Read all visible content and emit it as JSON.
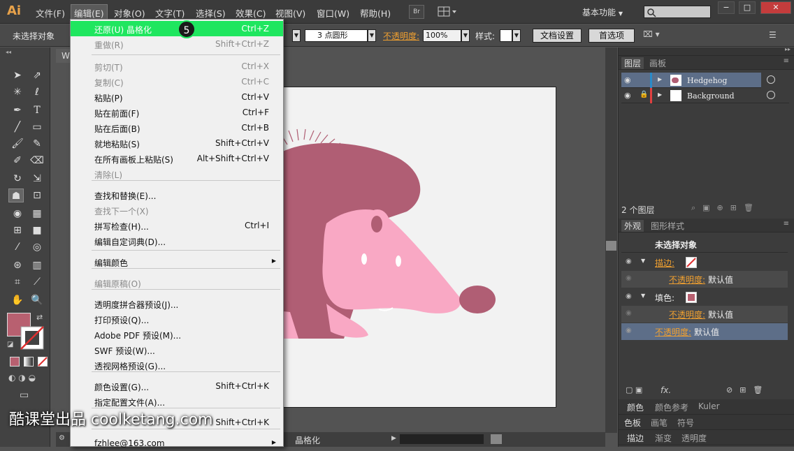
{
  "menubar": {
    "logo": "Ai",
    "items": [
      "文件(F)",
      "编辑(E)",
      "对象(O)",
      "文字(T)",
      "选择(S)",
      "效果(C)",
      "视图(V)",
      "窗口(W)",
      "帮助(H)"
    ],
    "br": "Br",
    "workspace": "基本功能",
    "win_min": "−",
    "win_max": "□",
    "win_close": "✕"
  },
  "control": {
    "no_selection": "未选择对象",
    "stroke_profile": "3 点圆形",
    "opacity_label": "不透明度:",
    "opacity_value": "100%",
    "style_label": "样式:",
    "doc_setup": "文档设置",
    "prefs": "首选项"
  },
  "doc": {
    "tab_prefix": "W",
    "status_mode": "晶格化"
  },
  "layers": {
    "tabs": [
      "图层",
      "画板"
    ],
    "rows": [
      {
        "name": "Hedgehog",
        "color": "#2a8ac8"
      },
      {
        "name": "Background",
        "color": "#e04040"
      }
    ],
    "count": "2 个图层"
  },
  "appearance": {
    "tabs": [
      "外观",
      "图形样式"
    ],
    "title": "未选择对象",
    "stroke_label": "描边:",
    "opacity_label": "不透明度:",
    "default_value": "默认值",
    "fill_label": "填色:",
    "fx": "fx."
  },
  "bottompanels": [
    [
      "颜色",
      "颜色参考",
      "Kuler"
    ],
    [
      "色板",
      "画笔",
      "符号"
    ],
    [
      "描边",
      "渐变",
      "透明度"
    ]
  ],
  "colors": {
    "fill": "#b86070",
    "hedgehog_body": "#b05e74",
    "hedgehog_face": "#f9a8c4",
    "nose": "#b05e74",
    "menu_highlight": "#1fe65f"
  },
  "editmenu": {
    "items": [
      {
        "label": "还原(U) 晶格化",
        "shortcut": "Ctrl+Z",
        "state": "highlight"
      },
      {
        "label": "重做(R)",
        "shortcut": "Shift+Ctrl+Z",
        "state": "disabled"
      },
      {
        "label": "剪切(T)",
        "shortcut": "Ctrl+X",
        "state": "disabled"
      },
      {
        "label": "复制(C)",
        "shortcut": "Ctrl+C",
        "state": "disabled"
      },
      {
        "label": "粘贴(P)",
        "shortcut": "Ctrl+V",
        "state": "normal"
      },
      {
        "label": "贴在前面(F)",
        "shortcut": "Ctrl+F",
        "state": "normal"
      },
      {
        "label": "贴在后面(B)",
        "shortcut": "Ctrl+B",
        "state": "normal"
      },
      {
        "label": "就地粘贴(S)",
        "shortcut": "Shift+Ctrl+V",
        "state": "normal"
      },
      {
        "label": "在所有画板上粘贴(S)",
        "shortcut": "Alt+Shift+Ctrl+V",
        "state": "normal"
      },
      {
        "label": "清除(L)",
        "shortcut": "",
        "state": "disabled"
      },
      {
        "label": "查找和替换(E)...",
        "shortcut": "",
        "state": "normal"
      },
      {
        "label": "查找下一个(X)",
        "shortcut": "",
        "state": "disabled"
      },
      {
        "label": "拼写检查(H)...",
        "shortcut": "Ctrl+I",
        "state": "normal"
      },
      {
        "label": "编辑自定词典(D)...",
        "shortcut": "",
        "state": "normal"
      },
      {
        "label": "编辑颜色",
        "shortcut": "",
        "state": "submenu"
      },
      {
        "label": "编辑原稿(O)",
        "shortcut": "",
        "state": "disabled"
      },
      {
        "label": "透明度拼合器预设(J)...",
        "shortcut": "",
        "state": "normal"
      },
      {
        "label": "打印预设(Q)...",
        "shortcut": "",
        "state": "normal"
      },
      {
        "label": "Adobe PDF 预设(M)...",
        "shortcut": "",
        "state": "normal"
      },
      {
        "label": "SWF 预设(W)...",
        "shortcut": "",
        "state": "normal"
      },
      {
        "label": "透视网格预设(G)...",
        "shortcut": "",
        "state": "normal"
      },
      {
        "label": "颜色设置(G)...",
        "shortcut": "Shift+Ctrl+K",
        "state": "normal"
      },
      {
        "label": "指定配置文件(A)...",
        "shortcut": "",
        "state": "normal"
      },
      {
        "label": "",
        "shortcut": "Shift+Ctrl+K",
        "state": "normal"
      },
      {
        "label": "fzhlee@163.com",
        "shortcut": "",
        "state": "submenu"
      }
    ]
  },
  "step_badge": "5",
  "watermark": "酷课堂出品 coolketang.com"
}
